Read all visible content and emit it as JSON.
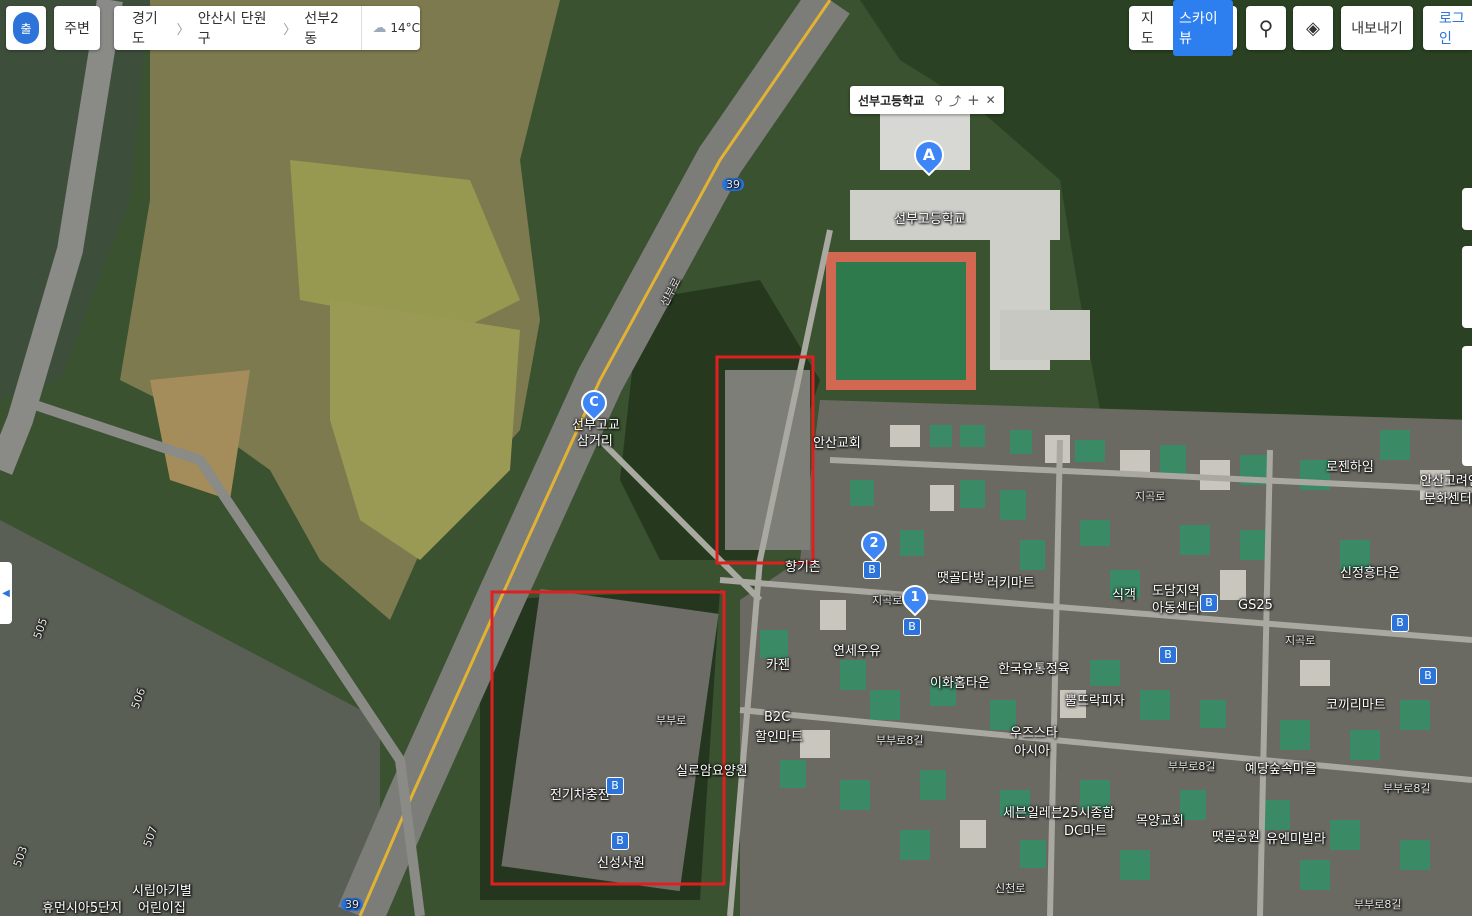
{
  "header": {
    "logo_char": "출",
    "nearby_label": "주변",
    "breadcrumb": [
      "경기도",
      "안산시 단원구",
      "선부2동"
    ],
    "weather": "14°C"
  },
  "map_controls": {
    "map_label": "지도",
    "skyview_label": "스카이뷰",
    "export_label": "내보내기",
    "login_label": "로그인"
  },
  "popup": {
    "title": "선부고등학교"
  },
  "markers": {
    "a": "A",
    "c": "C",
    "one": "1",
    "two": "2"
  },
  "labels": {
    "school": "선부고등학교",
    "crossroad_1": "선부고교",
    "crossroad_2": "삼거리",
    "ansan_church": "안산교회",
    "lozen": "로젠하임",
    "ansan_goryeo_1": "안산고려인",
    "ansan_goryeo_2": "문화센터",
    "sinjeong": "신정흥타운",
    "sikgaek": "식객",
    "dodam_1": "도담지역",
    "dodam_2": "아동센터",
    "gs25": "GS25",
    "ttaetgol_dabang": "땟골다방",
    "leki_mart": "러키마트",
    "kajen": "카젠",
    "yeonse_milk": "연세우유",
    "korea_dist": "한국유통정육",
    "ihwa": "이화홈타운",
    "ppul_pija": "뿔뜨락피자",
    "kokkiri": "코끼리마트",
    "b2c_1": "B2C",
    "b2c_2": "할인마트",
    "woojoo_1": "우즈스타",
    "woojoo_2": "아시아",
    "silroam": "실로암요양원",
    "yedang": "예당숲속마을",
    "ev_charge": "전기차충전",
    "seven_eleven": "세븐일레븐",
    "dc_mart_1": "25시종합",
    "dc_mart_2": "DC마트",
    "mokyang": "목양교회",
    "ttaetgol_park": "땟골공원",
    "youen_villa": "유엔미빌라",
    "sinseong": "신성사원",
    "daycare_1": "시립아기별",
    "daycare_2": "어린이집",
    "hue_apt": "휴먼시아5단지",
    "hyanggi_chon": "향기촌",
    "road_39a": "39",
    "road_39b": "39",
    "road_505": "505",
    "road_506": "506",
    "road_507": "507",
    "road_503": "503",
    "road_jigok_1": "지곡로",
    "road_jigok_2": "지곡로",
    "road_jigok_3": "지곡로",
    "road_bubu_1": "부부로",
    "road_bubu_2": "부부로8길",
    "road_bubu_3": "부부로8길",
    "road_bubu_4": "부부로8길",
    "road_seonbu": "선부로",
    "road_sincheon": "신천로",
    "road_bubu_5": "부부로8길"
  },
  "highlight_color": "#e02020"
}
